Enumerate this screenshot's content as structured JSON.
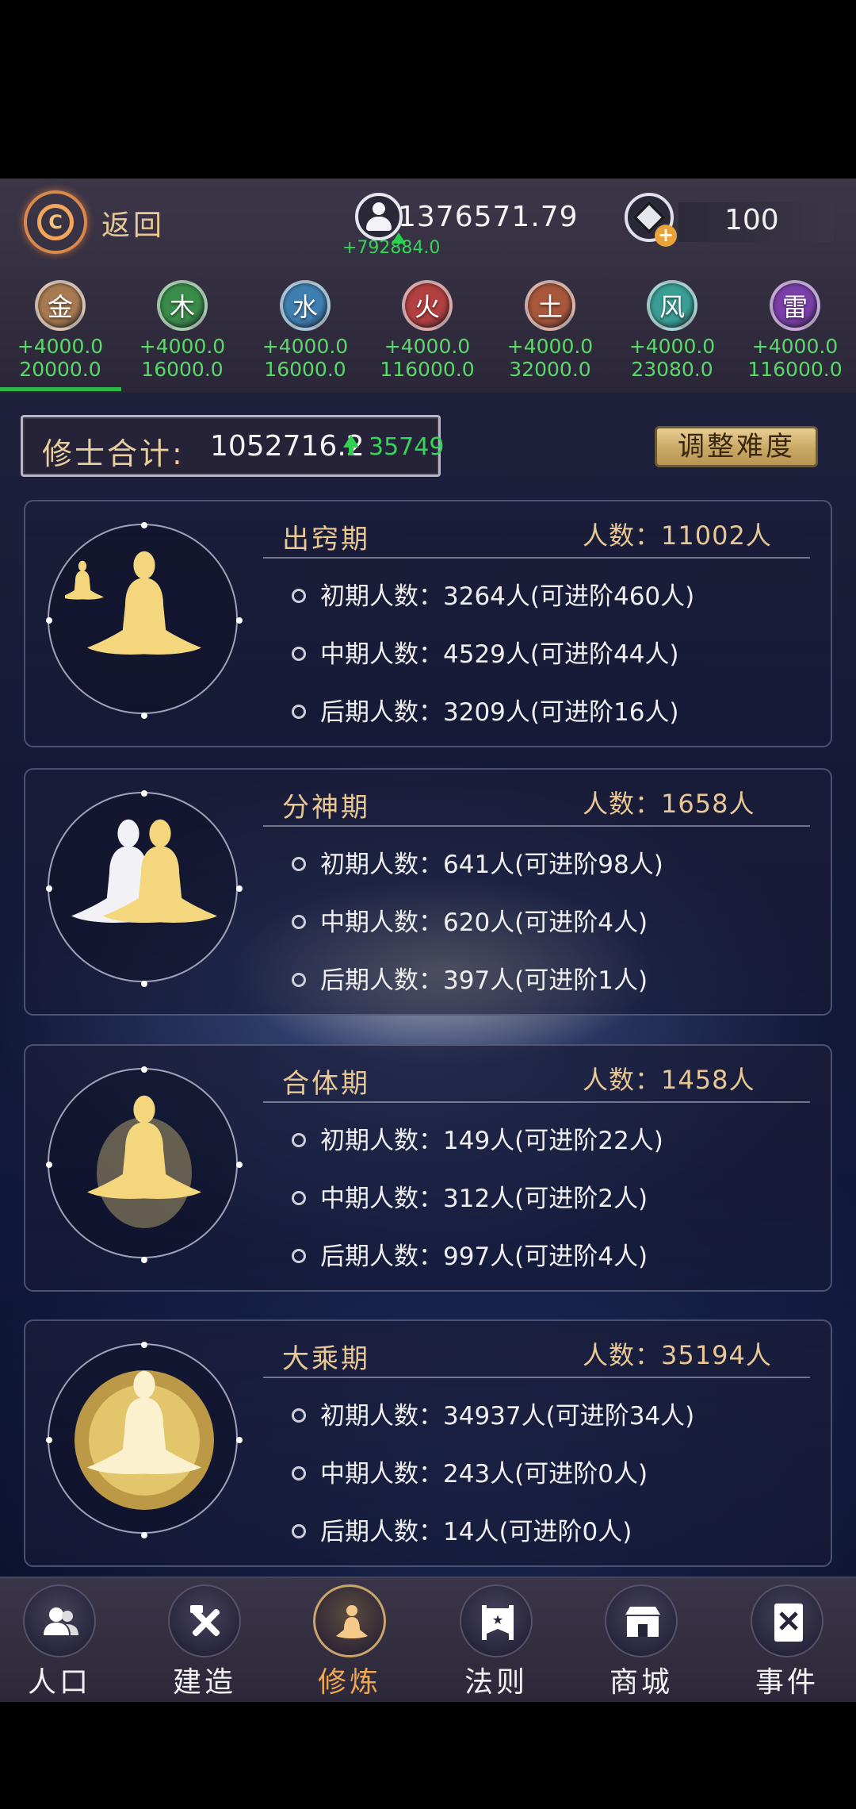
{
  "header": {
    "back_label": "返回",
    "population": "1376571.79",
    "population_delta": "+792884.0",
    "gems": "100"
  },
  "elements": [
    {
      "glyph": "金",
      "rate": "+4000.0",
      "total": "20000.0",
      "color": "#a87a52"
    },
    {
      "glyph": "木",
      "rate": "+4000.0",
      "total": "16000.0",
      "color": "#3a8c4a"
    },
    {
      "glyph": "水",
      "rate": "+4000.0",
      "total": "16000.0",
      "color": "#3f7fb0"
    },
    {
      "glyph": "火",
      "rate": "+4000.0",
      "total": "116000.0",
      "color": "#b24040"
    },
    {
      "glyph": "土",
      "rate": "+4000.0",
      "total": "32000.0",
      "color": "#a8573c"
    },
    {
      "glyph": "风",
      "rate": "+4000.0",
      "total": "23080.0",
      "color": "#3a9e96"
    },
    {
      "glyph": "雷",
      "rate": "+4000.0",
      "total": "116000.0",
      "color": "#7a3fa8"
    }
  ],
  "summary": {
    "label": "修士合计:",
    "total": "1052716.2",
    "increase": "35749",
    "adjust_button": "调整难度"
  },
  "realms": [
    {
      "name": "出窍期",
      "count": "人数：11002人",
      "lines": [
        "初期人数：3264人(可进阶460人)",
        "中期人数：4529人(可进阶44人)",
        "后期人数：3209人(可进阶16人)"
      ]
    },
    {
      "name": "分神期",
      "count": "人数：1658人",
      "lines": [
        "初期人数：641人(可进阶98人)",
        "中期人数：620人(可进阶4人)",
        "后期人数：397人(可进阶1人)"
      ]
    },
    {
      "name": "合体期",
      "count": "人数：1458人",
      "lines": [
        "初期人数：149人(可进阶22人)",
        "中期人数：312人(可进阶2人)",
        "后期人数：997人(可进阶4人)"
      ]
    },
    {
      "name": "大乘期",
      "count": "人数：35194人",
      "lines": [
        "初期人数：34937人(可进阶34人)",
        "中期人数：243人(可进阶0人)",
        "后期人数：14人(可进阶0人)"
      ]
    }
  ],
  "nav": [
    {
      "label": "人口",
      "icon": "people-icon"
    },
    {
      "label": "建造",
      "icon": "tools-icon"
    },
    {
      "label": "修炼",
      "icon": "meditation-icon",
      "active": true
    },
    {
      "label": "法则",
      "icon": "banner-icon"
    },
    {
      "label": "商城",
      "icon": "shop-icon"
    },
    {
      "label": "事件",
      "icon": "event-book-icon"
    }
  ]
}
